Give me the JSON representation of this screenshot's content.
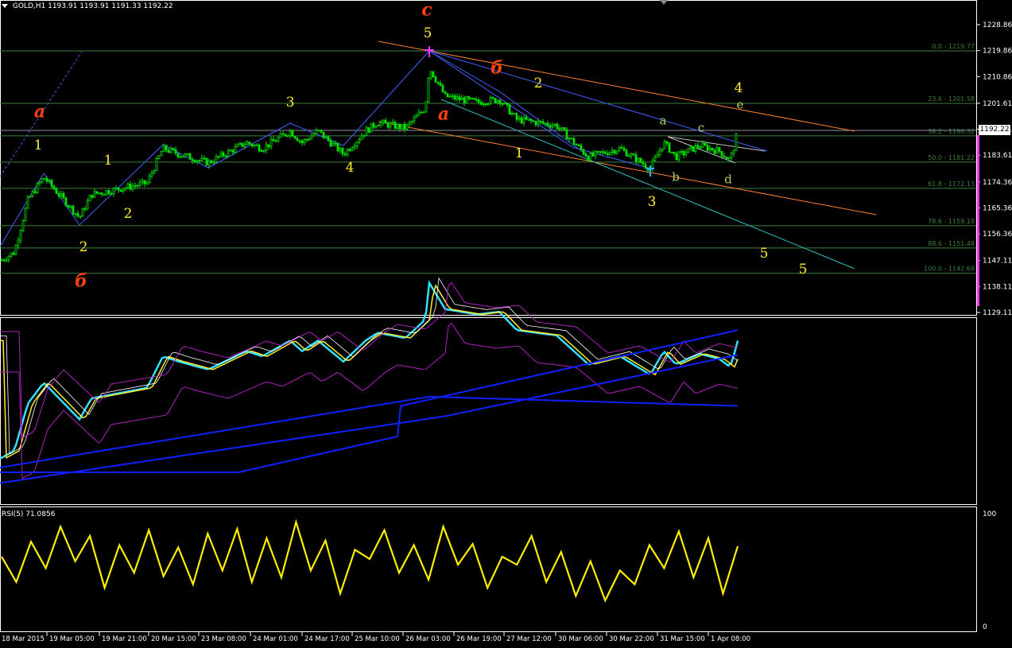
{
  "header": {
    "symbol": "GOLD,H1",
    "ohlc": "1193.91 1193.91 1191.33 1192.22"
  },
  "price_axis": {
    "labels": [
      "1228.86",
      "1219.86",
      "1210.86",
      "1201.61",
      "1192.61",
      "1183.61",
      "1174.36",
      "1165.36",
      "1156.36",
      "1147.11",
      "1138.11",
      "1129.11"
    ],
    "current_price": "1192.22"
  },
  "time_axis": {
    "labels": [
      "18 Mar 2015",
      "19 Mar 05:00",
      "19 Mar 21:00",
      "20 Mar 15:00",
      "23 Mar 08:00",
      "24 Mar 01:00",
      "24 Mar 17:00",
      "25 Mar 10:00",
      "26 Mar 03:00",
      "26 Mar 19:00",
      "27 Mar 12:00",
      "30 Mar 06:00",
      "30 Mar 22:00",
      "31 Mar 15:00",
      "1 Apr 08:00"
    ]
  },
  "fibonacci": {
    "levels": [
      {
        "label": "0.0 - 1219.77",
        "price": 1219.77
      },
      {
        "label": "23.6 - 1201.58",
        "price": 1201.58
      },
      {
        "label": "38.2 - 1190.32",
        "price": 1190.32
      },
      {
        "label": "50.0 - 1181.22",
        "price": 1181.22
      },
      {
        "label": "61.8 - 1172.13",
        "price": 1172.13
      },
      {
        "label": "78.6 - 1159.18",
        "price": 1159.18
      },
      {
        "label": "88.6 - 1151.48",
        "price": 1151.48
      },
      {
        "label": "100.0 - 1142.69",
        "price": 1142.69
      }
    ],
    "color": "#3a7f3a"
  },
  "wave_labels": [
    {
      "text": "c",
      "color": "#ff4010",
      "size": 22,
      "italic": true
    },
    {
      "text": "5",
      "color": "#ffee30",
      "size": 17,
      "italic": false
    },
    {
      "text": "б",
      "color": "#ff4010",
      "size": 22,
      "italic": true
    },
    {
      "text": "2",
      "color": "#ffee30",
      "size": 17,
      "italic": false
    },
    {
      "text": "a",
      "color": "#ff4010",
      "size": 22,
      "italic": true
    },
    {
      "text": "4",
      "color": "#ffee30",
      "size": 17,
      "italic": false
    },
    {
      "text": "e",
      "color": "#b0d060",
      "size": 15,
      "italic": false
    },
    {
      "text": "a",
      "color": "#b0d060",
      "size": 15,
      "italic": false
    },
    {
      "text": "c",
      "color": "#b0d060",
      "size": 15,
      "italic": false
    },
    {
      "text": "b",
      "color": "#b0d060",
      "size": 15,
      "italic": false
    },
    {
      "text": "d",
      "color": "#b0d060",
      "size": 15,
      "italic": false
    },
    {
      "text": "1",
      "color": "#ffee30",
      "size": 17,
      "italic": false
    },
    {
      "text": "3",
      "color": "#ffee30",
      "size": 17,
      "italic": false
    },
    {
      "text": "5",
      "color": "#ffee30",
      "size": 17,
      "italic": false
    },
    {
      "text": "5",
      "color": "#ffee30",
      "size": 17,
      "italic": false
    },
    {
      "text": "3",
      "color": "#ffee30",
      "size": 17,
      "italic": false
    },
    {
      "text": "4",
      "color": "#ffee30",
      "size": 17,
      "italic": false
    },
    {
      "text": "a",
      "color": "#ff4010",
      "size": 22,
      "italic": true
    },
    {
      "text": "1",
      "color": "#ffee30",
      "size": 17,
      "italic": false
    },
    {
      "text": "1",
      "color": "#ffee30",
      "size": 17,
      "italic": false
    },
    {
      "text": "2",
      "color": "#ffee30",
      "size": 17,
      "italic": false
    },
    {
      "text": "2",
      "color": "#ffee30",
      "size": 17,
      "italic": false
    },
    {
      "text": "б",
      "color": "#ff4010",
      "size": 22,
      "italic": true
    }
  ],
  "rsi": {
    "title": "RSI(5) 71.0856",
    "axis_labels": [
      "100",
      "0"
    ],
    "color": "#ffee00"
  },
  "colors": {
    "candle": "#00e000",
    "grid_line": "#3a7f3a",
    "channel_orange": "#ff8030",
    "channel_cyan": "#30c0c0",
    "wave_blue": "#4060ff",
    "bands_blue": "#1020ff",
    "bands_purple": "#b020c0",
    "pane_border": "#ffffff"
  },
  "chart_data": {
    "type": "line",
    "title": "GOLD,H1",
    "series": [
      {
        "name": "RSI(5)",
        "values": [
          62,
          40,
          75,
          52,
          88,
          58,
          80,
          35,
          72,
          48,
          85,
          45,
          70,
          38,
          82,
          50,
          86,
          40,
          78,
          44,
          92,
          50,
          76,
          30,
          68,
          60,
          85,
          48,
          72,
          42,
          88,
          55,
          73,
          35,
          62,
          55,
          80,
          40,
          66,
          28,
          58,
          24,
          50,
          38,
          72,
          52,
          84,
          44,
          78,
          30,
          71
        ]
      }
    ],
    "ylim": [
      0,
      100
    ]
  }
}
